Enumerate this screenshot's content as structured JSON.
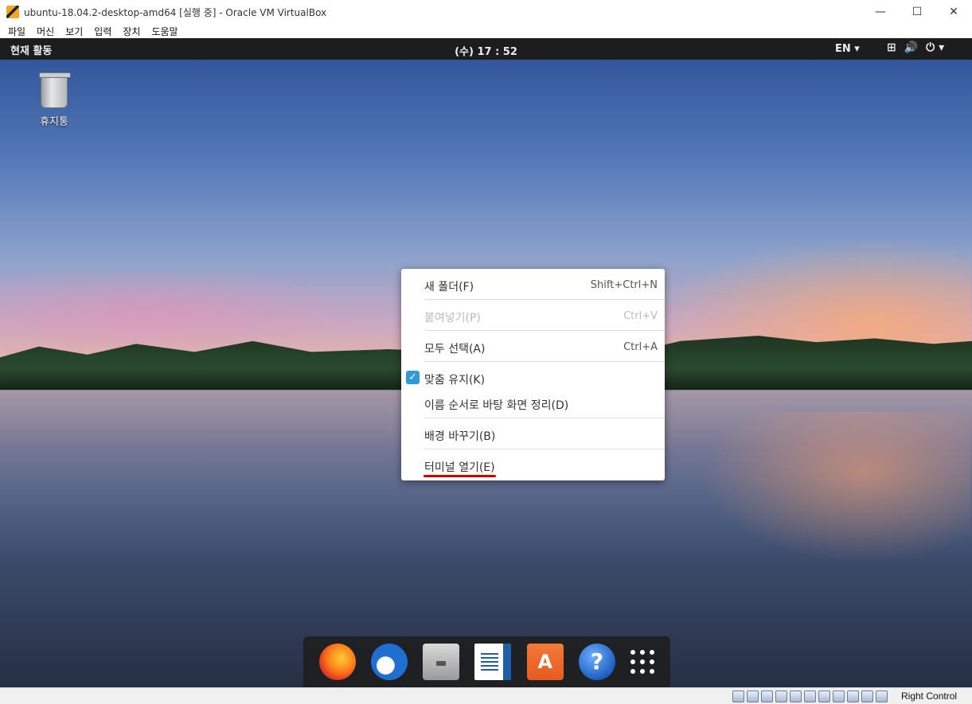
{
  "window": {
    "title": "ubuntu-18.04.2-desktop-amd64 [실행 중] - Oracle VM VirtualBox",
    "controls": {
      "minimize": "—",
      "maximize": "☐",
      "close": "✕"
    }
  },
  "menubar": {
    "items": [
      "파일",
      "머신",
      "보기",
      "입력",
      "장치",
      "도움말"
    ]
  },
  "top_panel": {
    "activities": "현재 활동",
    "clock": "(수) 17 : 52",
    "language": "EN ▾",
    "tray_icons": [
      "network-icon",
      "volume-icon",
      "power-icon"
    ],
    "tray_glyphs": {
      "network": "⊞",
      "volume": "🔊",
      "power": "⏻ ▾"
    }
  },
  "desktop": {
    "trash_label": "휴지통"
  },
  "context_menu": {
    "items": [
      {
        "label": "새 폴더(F)",
        "accel": "Shift+Ctrl+N",
        "enabled": true
      },
      {
        "label": "붙여넣기(P)",
        "accel": "Ctrl+V",
        "enabled": false
      },
      {
        "label": "모두 선택(A)",
        "accel": "Ctrl+A",
        "enabled": true
      },
      {
        "label": "맞춤 유지(K)",
        "accel": "",
        "enabled": true,
        "checked": true
      },
      {
        "label": "이름 순서로 바탕 화면 정리(D)",
        "accel": "",
        "enabled": true
      },
      {
        "label": "배경 바꾸기(B)",
        "accel": "",
        "enabled": true
      },
      {
        "label": "터미널 열기(E)",
        "accel": "",
        "enabled": true,
        "highlighted_underline": true
      }
    ],
    "check_glyph": "✓",
    "underline_color": "#d40000"
  },
  "dock": {
    "apps": [
      "firefox-icon",
      "thunderbird-icon",
      "files-icon",
      "libreoffice-writer-icon",
      "software-store-icon",
      "help-icon",
      "show-applications-icon"
    ],
    "store_glyph": "A",
    "help_glyph": "?"
  },
  "statusbar": {
    "host_key": "Right Control"
  },
  "colors": {
    "panel": "#1d1d1d",
    "accent": "#2d9bd8"
  }
}
